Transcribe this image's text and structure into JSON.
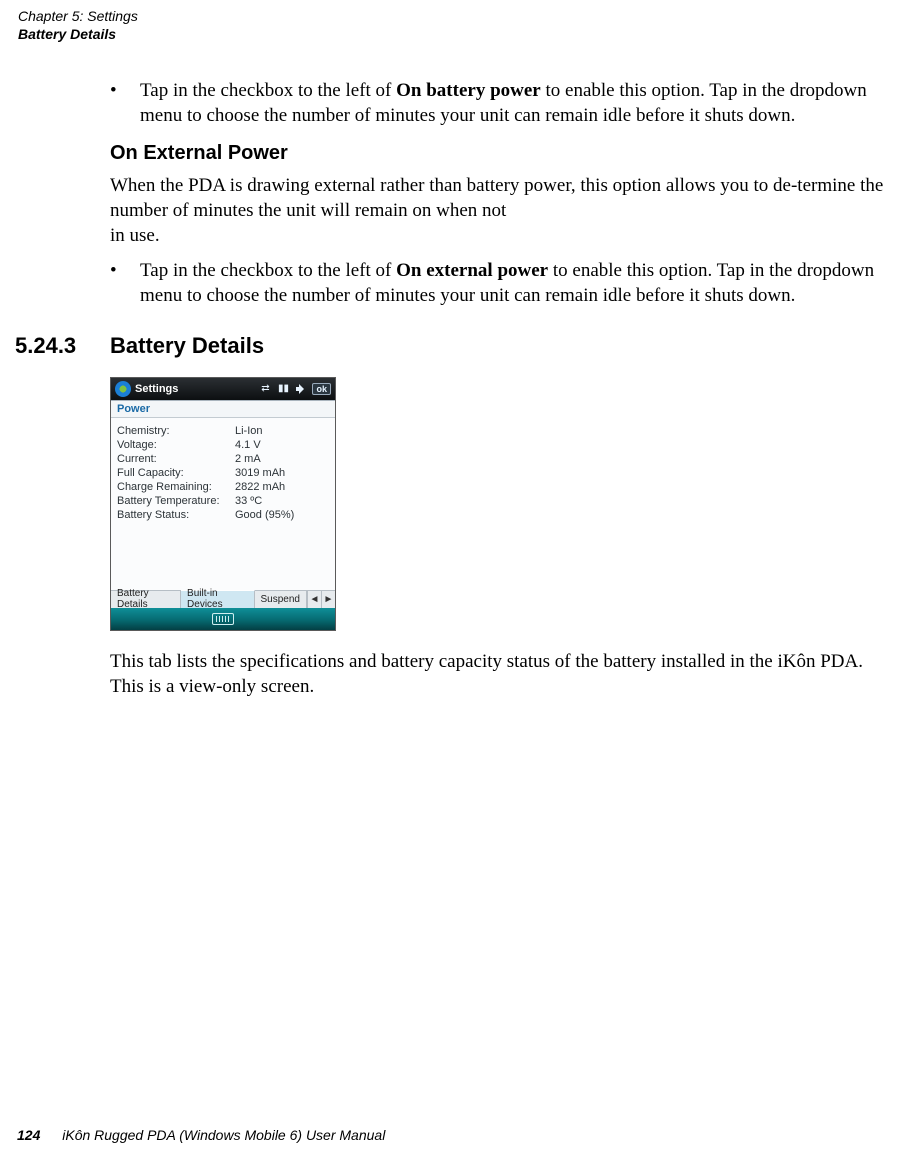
{
  "running_head": {
    "chapter": "Chapter 5:  Settings",
    "section": "Battery Details"
  },
  "bullet1": {
    "pre": "Tap in the checkbox to the left of ",
    "bold": "On battery power",
    "post": " to enable this option. Tap in the dropdown menu to choose the number of minutes your unit can remain idle before it shuts down."
  },
  "h3_ext_power": "On External Power",
  "para_ext_power": "When the PDA is drawing external rather than battery power, this option allows you to de-termine the number of minutes the unit will remain on when not\nin use.",
  "bullet2": {
    "pre": "Tap in the checkbox to the left of ",
    "bold": "On external power",
    "post": " to enable this option. Tap in the dropdown menu to choose the number of minutes your unit can remain idle before it shuts down."
  },
  "section": {
    "num": "5.24.3",
    "title": "Battery Details"
  },
  "screenshot": {
    "titlebar": {
      "title": "Settings",
      "ok": "ok"
    },
    "subtitle": "Power",
    "rows": [
      {
        "label": "Chemistry:",
        "value": "Li-Ion"
      },
      {
        "label": "Voltage:",
        "value": "4.1 V"
      },
      {
        "label": "Current:",
        "value": "2 mA"
      },
      {
        "label": "Full Capacity:",
        "value": "3019 mAh"
      },
      {
        "label": "Charge Remaining:",
        "value": "2822 mAh"
      },
      {
        "label": "Battery Temperature:",
        "value": "33 ºC"
      },
      {
        "label": "Battery Status:",
        "value": "Good  (95%)"
      }
    ],
    "tabs": {
      "t1": "Battery Details",
      "t2": "Built-in Devices",
      "t3": "Suspend",
      "left": "◄",
      "right": "►"
    }
  },
  "para_after_shot": "This tab lists the specifications and battery capacity status of the battery installed in the iKôn PDA. This is a view-only screen.",
  "footer": {
    "page": "124",
    "book": "iKôn Rugged PDA (Windows Mobile 6) User Manual"
  }
}
